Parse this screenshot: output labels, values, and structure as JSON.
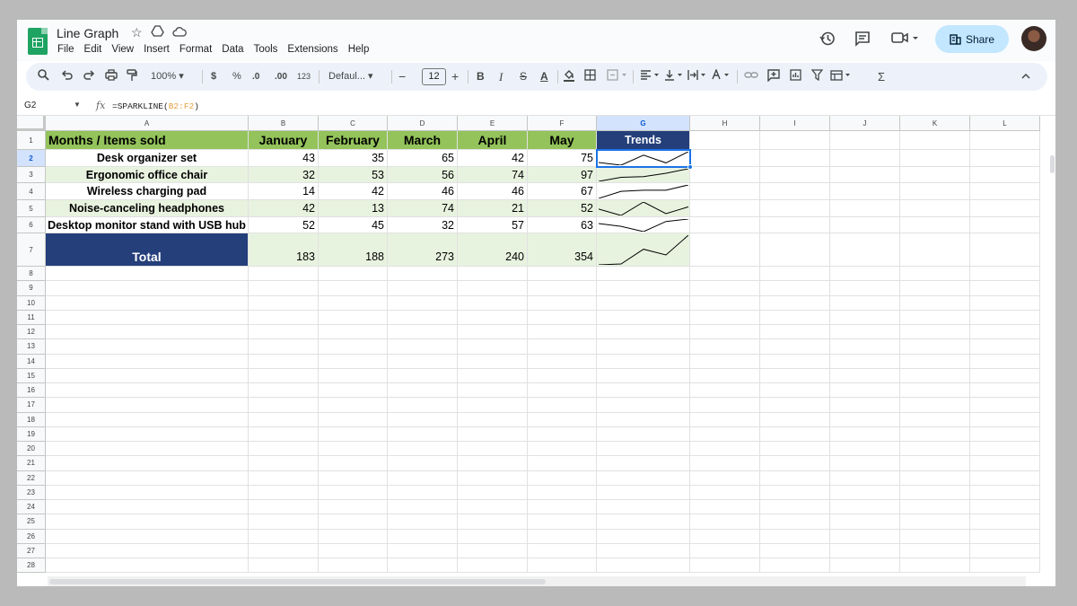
{
  "doc": {
    "title": "Line Graph"
  },
  "menu": [
    "File",
    "Edit",
    "View",
    "Insert",
    "Format",
    "Data",
    "Tools",
    "Extensions",
    "Help"
  ],
  "header": {
    "share_label": "Share"
  },
  "toolbar": {
    "zoom": "100%",
    "font": "Defaul...",
    "font_size": "12",
    "currency": "$",
    "percent": "%",
    "dec_decrease": ".0",
    "dec_increase": ".00",
    "number_format": "123"
  },
  "formula_bar": {
    "cell_ref": "G2",
    "formula_prefix": "=SPARKLINE(",
    "formula_range": "B2:F2",
    "formula_suffix": ")"
  },
  "columns": [
    "A",
    "B",
    "C",
    "D",
    "E",
    "F",
    "G",
    "H",
    "I",
    "J",
    "K",
    "L"
  ],
  "rows": [
    "1",
    "2",
    "3",
    "4",
    "5",
    "6",
    "7",
    "8",
    "9",
    "10",
    "11",
    "12",
    "13",
    "14",
    "15",
    "16",
    "17",
    "18",
    "19",
    "20",
    "21",
    "22",
    "23",
    "24",
    "25",
    "26",
    "27",
    "28"
  ],
  "sheet": {
    "header_row": [
      "Months / Items sold",
      "January",
      "February",
      "March",
      "April",
      "May",
      "Trends"
    ],
    "items": [
      {
        "name": "Desk organizer set",
        "values": [
          "43",
          "35",
          "65",
          "42",
          "75"
        ]
      },
      {
        "name": "Ergonomic office chair",
        "values": [
          "32",
          "53",
          "56",
          "74",
          "97"
        ]
      },
      {
        "name": "Wireless charging pad",
        "values": [
          "14",
          "42",
          "46",
          "46",
          "67"
        ]
      },
      {
        "name": "Noise-canceling headphones",
        "values": [
          "42",
          "13",
          "74",
          "21",
          "52"
        ]
      },
      {
        "name": "Desktop monitor stand with USB hub",
        "values": [
          "52",
          "45",
          "32",
          "57",
          "63"
        ]
      }
    ],
    "total": {
      "label": "Total",
      "values": [
        "183",
        "188",
        "273",
        "240",
        "354"
      ]
    }
  },
  "colors": {
    "header_green": "#93c35a",
    "navy": "#243f7a",
    "band": "#e8f3df",
    "share_bg": "#c2e7ff",
    "selection": "#1a73e8"
  }
}
